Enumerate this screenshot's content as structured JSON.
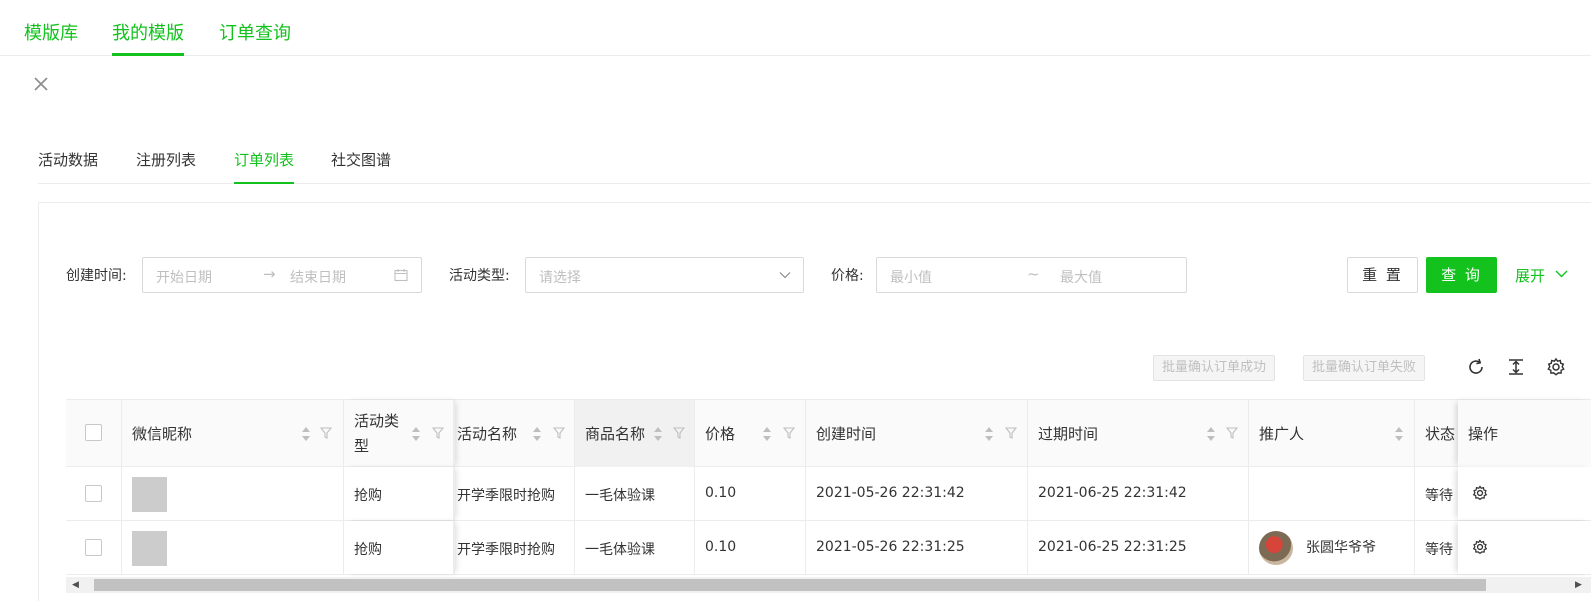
{
  "topnav": {
    "items": [
      {
        "label": "模版库"
      },
      {
        "label": "我的模版"
      },
      {
        "label": "订单查询"
      }
    ]
  },
  "subtabs": [
    "活动数据",
    "注册列表",
    "订单列表",
    "社交图谱"
  ],
  "filters": {
    "created_label": "创建时间:",
    "start_placeholder": "开始日期",
    "end_placeholder": "结束日期",
    "type_label": "活动类型:",
    "type_placeholder": "请选择",
    "price_label": "价格:",
    "min_placeholder": "最小值",
    "max_placeholder": "最大值",
    "reset": "重 置",
    "query": "查 询",
    "expand": "展开"
  },
  "toolbar": {
    "batch_success": "批量确认订单成功",
    "batch_fail": "批量确认订单失败"
  },
  "icons": {
    "close": "close-icon",
    "calendar": "calendar-icon",
    "chevron": "chevron-down-icon",
    "refresh": "refresh-icon",
    "density": "column-height-icon",
    "settings": "gear-icon"
  },
  "colors": {
    "accent": "#13c21d",
    "thumb": "#cccccc"
  },
  "table": {
    "headers": [
      "微信昵称",
      "活动类型",
      "活动名称",
      "商品名称",
      "价格",
      "创建时间",
      "过期时间",
      "推广人",
      "状态",
      "操作"
    ],
    "header_type_line1": "活动类",
    "header_type_line2": "型",
    "rows": [
      {
        "type": "抢购",
        "activity": "开学季限时抢购",
        "product": "一毛体验课",
        "price": "0.10",
        "created": "2021-05-26 22:31:42",
        "expires": "2021-06-25 22:31:42",
        "promoter": "",
        "status": "等待"
      },
      {
        "type": "抢购",
        "activity": "开学季限时抢购",
        "product": "一毛体验课",
        "price": "0.10",
        "created": "2021-05-26 22:31:25",
        "expires": "2021-06-25 22:31:25",
        "promoter": "张圆华爷爷",
        "status": "等待"
      }
    ]
  }
}
